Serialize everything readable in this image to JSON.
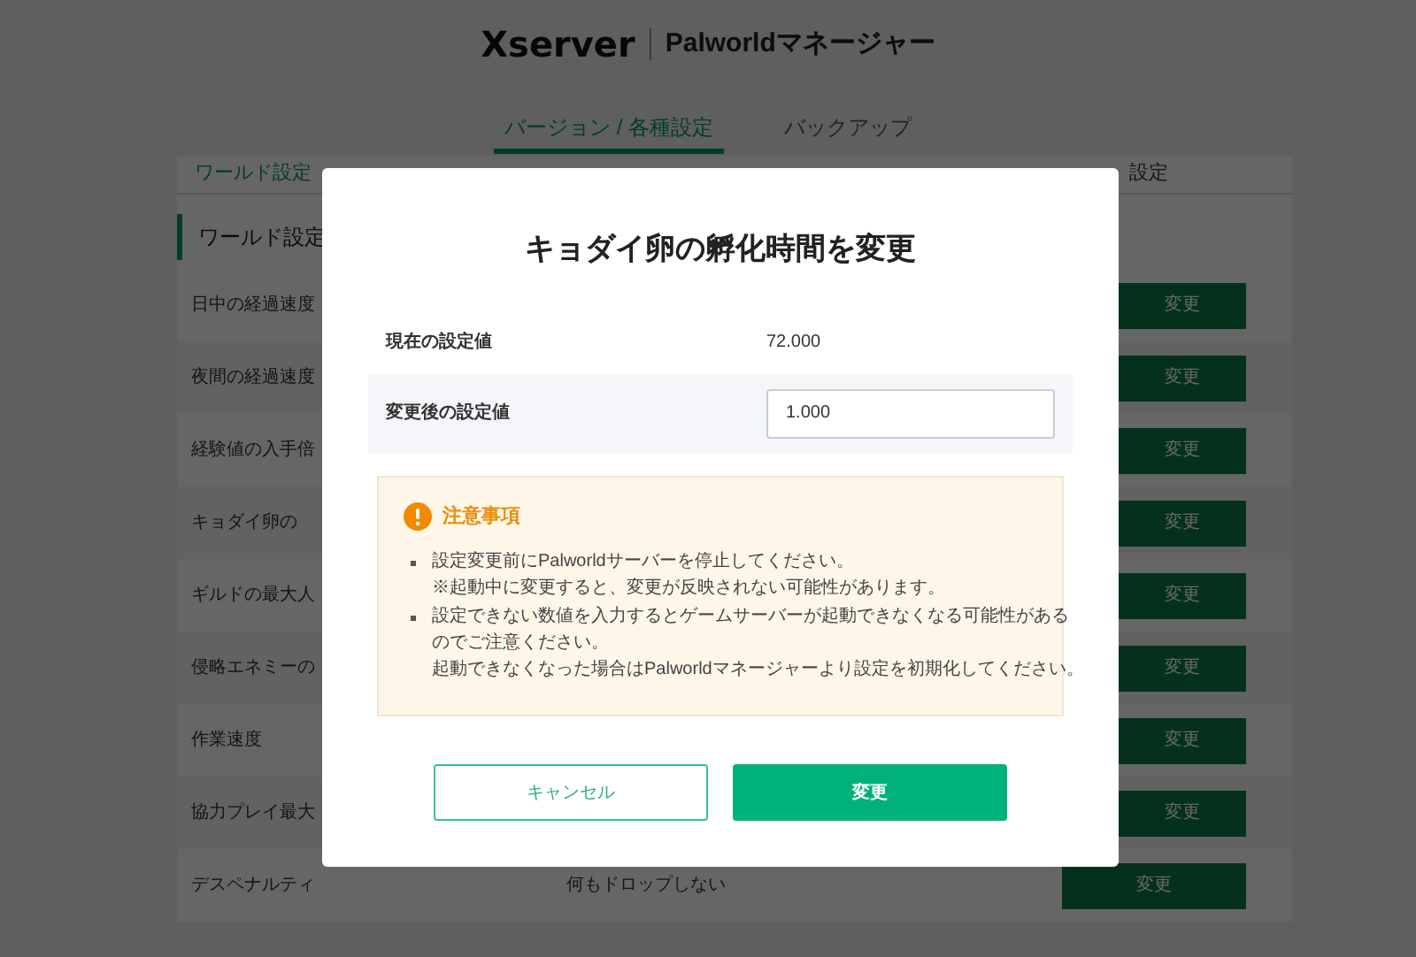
{
  "header": {
    "logo": "Xserver",
    "product": "Palworldマネージャー"
  },
  "tabs": [
    {
      "label": "バージョン / 各種設定",
      "selected": true
    },
    {
      "label": "バックアップ",
      "selected": false
    }
  ],
  "subnav": {
    "left": "ワールド設定",
    "right": "設定"
  },
  "section": {
    "title": "ワールド設定"
  },
  "rows": [
    {
      "label": "日中の経過速度",
      "button": "変更"
    },
    {
      "label": "夜間の経過速度",
      "button": "変更"
    },
    {
      "label": "経験値の入手倍",
      "button": "変更"
    },
    {
      "label": "キョダイ卵の",
      "button": "変更"
    },
    {
      "label": "ギルドの最大人",
      "button": "変更"
    },
    {
      "label": "侵略エネミーの",
      "button": "変更"
    },
    {
      "label": "作業速度",
      "button": "変更"
    },
    {
      "label": "協力プレイ最大",
      "button": "変更"
    },
    {
      "label": "デスペナルティ",
      "value": "何もドロップしない",
      "button": "変更"
    }
  ],
  "modal": {
    "title": "キョダイ卵の孵化時間を変更",
    "current": {
      "label": "現在の設定値",
      "value": "72.000"
    },
    "new": {
      "label": "変更後の設定値",
      "value": "1.000"
    },
    "notice": {
      "title": "注意事項",
      "items": [
        {
          "lines": [
            "設定変更前にPalworldサーバーを停止してください。",
            "※起動中に変更すると、変更が反映されない可能性があります。"
          ]
        },
        {
          "lines": [
            "設定できない数値を入力するとゲームサーバーが起動できなくなる可能性がある",
            "のでご注意ください。",
            "起動できなくなった場合はPalworldマネージャーより設定を初期化してください。"
          ]
        }
      ]
    },
    "cancel": "キャンセル",
    "confirm": "変更"
  }
}
